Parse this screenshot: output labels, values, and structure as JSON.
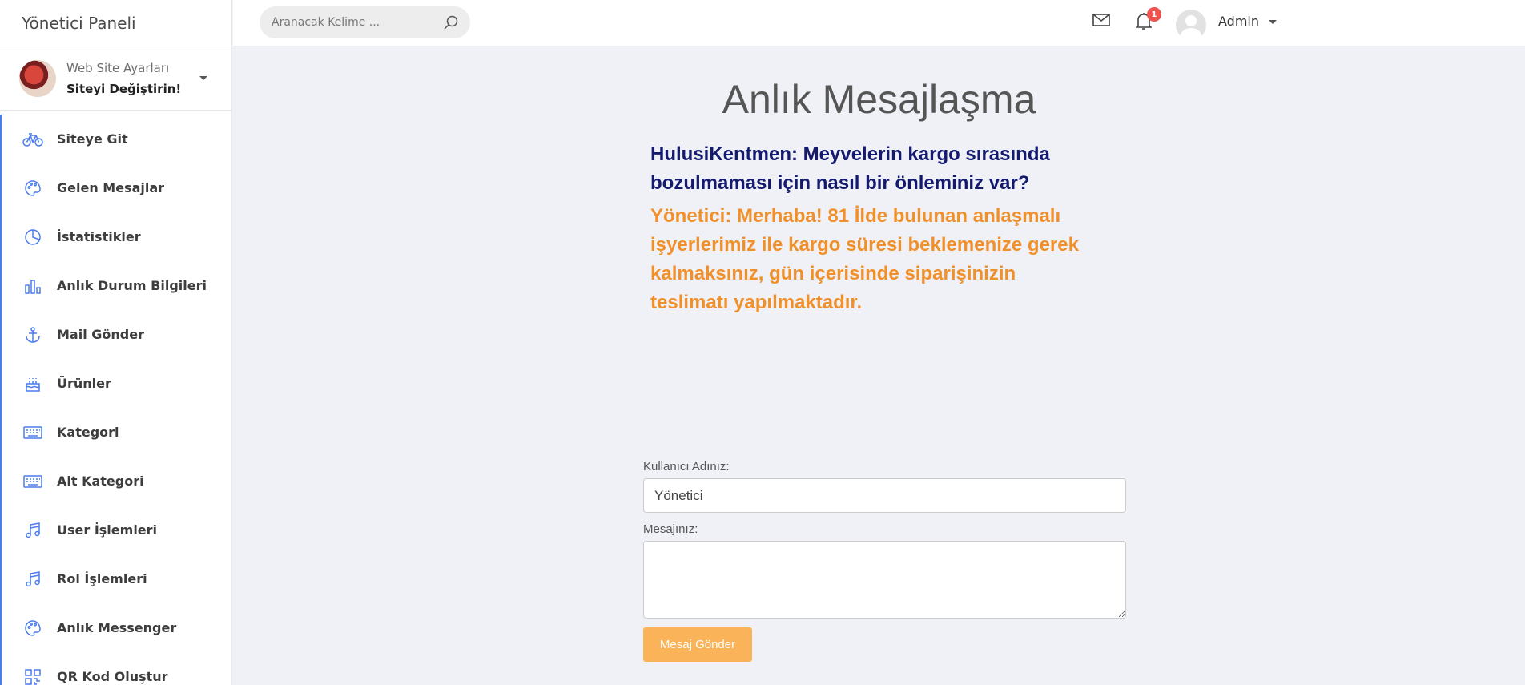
{
  "sidebar": {
    "brand": "Yönetici Paneli",
    "site": {
      "line1": "Web Site Ayarları",
      "line2": "Siteyi Değiştirin!"
    },
    "items": [
      {
        "label": "Siteye Git",
        "icon": "bicycle-icon"
      },
      {
        "label": "Gelen Mesajlar",
        "icon": "palette-icon"
      },
      {
        "label": "İstatistikler",
        "icon": "pie-chart-icon"
      },
      {
        "label": "Anlık Durum Bilgileri",
        "icon": "bar-chart-icon"
      },
      {
        "label": "Mail Gönder",
        "icon": "anchor-icon"
      },
      {
        "label": "Ürünler",
        "icon": "cake-icon"
      },
      {
        "label": "Kategori",
        "icon": "keyboard-icon"
      },
      {
        "label": "Alt Kategori",
        "icon": "keyboard-icon"
      },
      {
        "label": "User İşlemleri",
        "icon": "music-note-icon"
      },
      {
        "label": "Rol İşlemleri",
        "icon": "music-note-icon"
      },
      {
        "label": "Anlık Messenger",
        "icon": "palette-icon"
      },
      {
        "label": "QR Kod Oluştur",
        "icon": "qr-code-icon"
      }
    ]
  },
  "topbar": {
    "search_placeholder": "Aranacak Kelime ...",
    "notification_count": "1",
    "user_name": "Admin"
  },
  "main": {
    "title": "Anlık Mesajlaşma",
    "messages": [
      {
        "text": "HulusiKentmen: Meyvelerin kargo sırasında bozulmaması için nasıl bir önleminiz var?",
        "sender": "user",
        "color": "#141a6e"
      },
      {
        "text": "Yönetici: Merhaba! 81 İlde bulunan anlaşmalı işyerlerimiz ile kargo süresi beklemenize gerek kalmaksınız, gün içerisinde siparişinizin teslimatı yapılmaktadır.",
        "sender": "admin",
        "color": "#f0902a"
      }
    ],
    "form": {
      "username_label": "Kullanıcı Adınız:",
      "username_value": "Yönetici",
      "message_label": "Mesajınız:",
      "message_value": "",
      "send_label": "Mesaj Gönder"
    }
  },
  "colors": {
    "accent": "#4b7bec",
    "button": "#fbb35a",
    "badge": "#ef5350"
  }
}
